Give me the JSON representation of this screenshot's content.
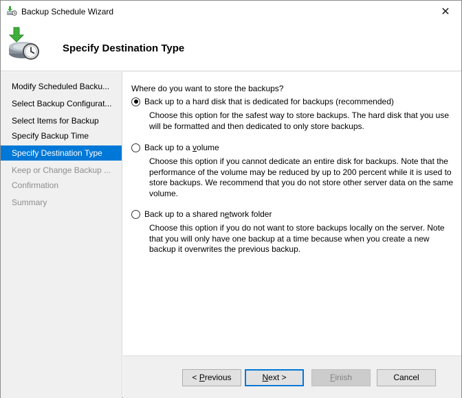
{
  "window": {
    "title": "Backup Schedule Wizard",
    "close_glyph": "✕"
  },
  "header": {
    "title": "Specify Destination Type",
    "icon": "backup-clock-icon"
  },
  "sidebar": {
    "items": [
      {
        "label": "Modify Scheduled Backu...",
        "state": "normal"
      },
      {
        "label": "Select Backup Configurat...",
        "state": "normal"
      },
      {
        "label": "Select Items for Backup",
        "state": "normal"
      },
      {
        "label": "Specify Backup Time",
        "state": "normal"
      },
      {
        "label": "Specify Destination Type",
        "state": "active"
      },
      {
        "label": "Keep or Change Backup ...",
        "state": "disabled"
      },
      {
        "label": "Confirmation",
        "state": "disabled"
      },
      {
        "label": "Summary",
        "state": "disabled"
      }
    ]
  },
  "content": {
    "question": "Where do you want to store the backups?",
    "options": [
      {
        "label_pre": "Back up to a hard disk that is dedicated for backups (recommended)",
        "label_ul": "",
        "label_post": "",
        "checked": true,
        "description": "Choose this option for the safest way to store backups. The hard disk that you use will be formatted and then dedicated to only store backups."
      },
      {
        "label_pre": "Back up to a ",
        "label_ul": "v",
        "label_post": "olume",
        "checked": false,
        "description": "Choose this option if you cannot dedicate an entire disk for backups. Note that the performance of the volume may be reduced by up to 200 percent while it is used to store backups. We recommend that you do not store other server data on the same volume."
      },
      {
        "label_pre": "Back up to a shared n",
        "label_ul": "e",
        "label_post": "twork folder",
        "checked": false,
        "description": "Choose this option if you do not want to store backups locally on the server. Note that you will only have one backup at a time because when you create a new backup it overwrites the previous backup."
      }
    ]
  },
  "footer": {
    "previous": {
      "pre": "< ",
      "ul": "P",
      "post": "revious"
    },
    "next": {
      "pre": "",
      "ul": "N",
      "post": "ext >"
    },
    "finish": {
      "pre": "",
      "ul": "F",
      "post": "inish"
    },
    "cancel": "Cancel"
  },
  "colors": {
    "accent": "#0078d7",
    "sidebar_bg": "#f0f0f0",
    "disabled_text": "#8d8d8d"
  }
}
